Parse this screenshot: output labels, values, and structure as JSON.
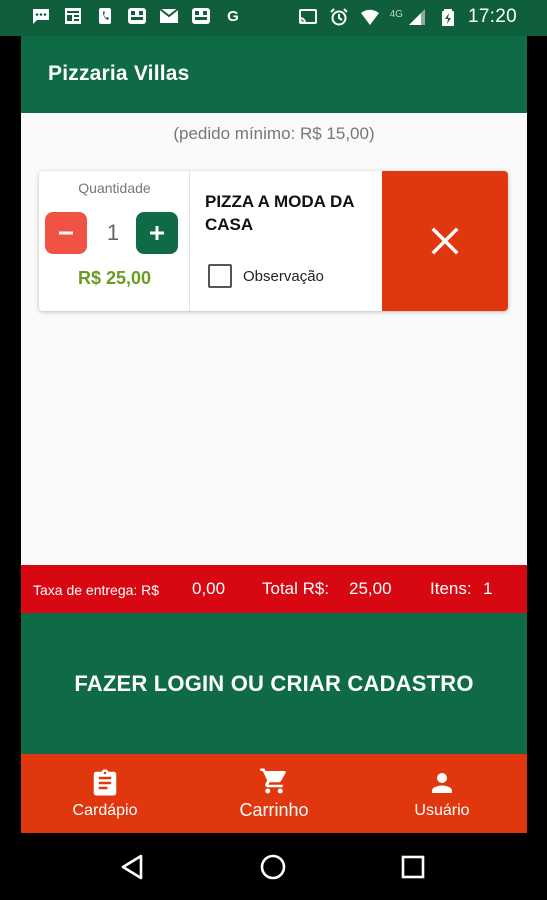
{
  "status_bar": {
    "time": "17:20",
    "network": "4G",
    "left_icons": [
      "chat-icon",
      "news-icon",
      "phone-icon",
      "app-icon",
      "mail-icon",
      "app-icon",
      "google-icon"
    ],
    "right_icons": [
      "cast-icon",
      "alarm-icon",
      "wifi-icon",
      "signal-icon",
      "battery-icon"
    ],
    "google_glyph": "G"
  },
  "app_bar": {
    "title": "Pizzaria Villas"
  },
  "min_order": "(pedido mínimo: R$ 15,00)",
  "cart_item": {
    "quantity_label": "Quantidade",
    "quantity": "1",
    "price": "R$ 25,00",
    "name": "PIZZA  A MODA DA CASA",
    "observation_label": "Observação",
    "observation_checked": false
  },
  "totals": {
    "delivery_label": "Taxa de entrega: R$",
    "delivery_value": "0,00",
    "total_label": "Total R$:",
    "total_value": "25,00",
    "items_label": "Itens:",
    "items_value": "1"
  },
  "login_button": "FAZER LOGIN OU CRIAR CADASTRO",
  "bottom_nav": [
    {
      "label": "Cardápio",
      "icon": "clipboard-icon"
    },
    {
      "label": "Carrinho",
      "icon": "cart-icon"
    },
    {
      "label": "Usuário",
      "icon": "person-icon"
    }
  ],
  "colors": {
    "primary_green": "#0f6b45",
    "accent_red": "#e0370f",
    "totals_red": "#d80812",
    "price_green": "#6a9c25",
    "minus_red": "#f05244"
  }
}
